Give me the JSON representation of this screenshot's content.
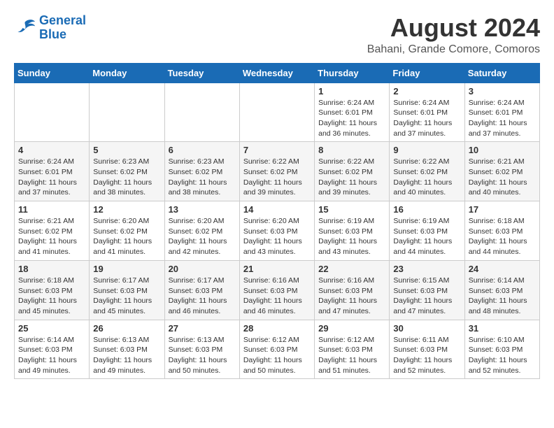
{
  "header": {
    "logo_line1": "General",
    "logo_line2": "Blue",
    "month_year": "August 2024",
    "location": "Bahani, Grande Comore, Comoros"
  },
  "days_of_week": [
    "Sunday",
    "Monday",
    "Tuesday",
    "Wednesday",
    "Thursday",
    "Friday",
    "Saturday"
  ],
  "weeks": [
    [
      {
        "day": "",
        "detail": ""
      },
      {
        "day": "",
        "detail": ""
      },
      {
        "day": "",
        "detail": ""
      },
      {
        "day": "",
        "detail": ""
      },
      {
        "day": "1",
        "detail": "Sunrise: 6:24 AM\nSunset: 6:01 PM\nDaylight: 11 hours\nand 36 minutes."
      },
      {
        "day": "2",
        "detail": "Sunrise: 6:24 AM\nSunset: 6:01 PM\nDaylight: 11 hours\nand 37 minutes."
      },
      {
        "day": "3",
        "detail": "Sunrise: 6:24 AM\nSunset: 6:01 PM\nDaylight: 11 hours\nand 37 minutes."
      }
    ],
    [
      {
        "day": "4",
        "detail": "Sunrise: 6:24 AM\nSunset: 6:01 PM\nDaylight: 11 hours\nand 37 minutes."
      },
      {
        "day": "5",
        "detail": "Sunrise: 6:23 AM\nSunset: 6:02 PM\nDaylight: 11 hours\nand 38 minutes."
      },
      {
        "day": "6",
        "detail": "Sunrise: 6:23 AM\nSunset: 6:02 PM\nDaylight: 11 hours\nand 38 minutes."
      },
      {
        "day": "7",
        "detail": "Sunrise: 6:22 AM\nSunset: 6:02 PM\nDaylight: 11 hours\nand 39 minutes."
      },
      {
        "day": "8",
        "detail": "Sunrise: 6:22 AM\nSunset: 6:02 PM\nDaylight: 11 hours\nand 39 minutes."
      },
      {
        "day": "9",
        "detail": "Sunrise: 6:22 AM\nSunset: 6:02 PM\nDaylight: 11 hours\nand 40 minutes."
      },
      {
        "day": "10",
        "detail": "Sunrise: 6:21 AM\nSunset: 6:02 PM\nDaylight: 11 hours\nand 40 minutes."
      }
    ],
    [
      {
        "day": "11",
        "detail": "Sunrise: 6:21 AM\nSunset: 6:02 PM\nDaylight: 11 hours\nand 41 minutes."
      },
      {
        "day": "12",
        "detail": "Sunrise: 6:20 AM\nSunset: 6:02 PM\nDaylight: 11 hours\nand 41 minutes."
      },
      {
        "day": "13",
        "detail": "Sunrise: 6:20 AM\nSunset: 6:02 PM\nDaylight: 11 hours\nand 42 minutes."
      },
      {
        "day": "14",
        "detail": "Sunrise: 6:20 AM\nSunset: 6:03 PM\nDaylight: 11 hours\nand 43 minutes."
      },
      {
        "day": "15",
        "detail": "Sunrise: 6:19 AM\nSunset: 6:03 PM\nDaylight: 11 hours\nand 43 minutes."
      },
      {
        "day": "16",
        "detail": "Sunrise: 6:19 AM\nSunset: 6:03 PM\nDaylight: 11 hours\nand 44 minutes."
      },
      {
        "day": "17",
        "detail": "Sunrise: 6:18 AM\nSunset: 6:03 PM\nDaylight: 11 hours\nand 44 minutes."
      }
    ],
    [
      {
        "day": "18",
        "detail": "Sunrise: 6:18 AM\nSunset: 6:03 PM\nDaylight: 11 hours\nand 45 minutes."
      },
      {
        "day": "19",
        "detail": "Sunrise: 6:17 AM\nSunset: 6:03 PM\nDaylight: 11 hours\nand 45 minutes."
      },
      {
        "day": "20",
        "detail": "Sunrise: 6:17 AM\nSunset: 6:03 PM\nDaylight: 11 hours\nand 46 minutes."
      },
      {
        "day": "21",
        "detail": "Sunrise: 6:16 AM\nSunset: 6:03 PM\nDaylight: 11 hours\nand 46 minutes."
      },
      {
        "day": "22",
        "detail": "Sunrise: 6:16 AM\nSunset: 6:03 PM\nDaylight: 11 hours\nand 47 minutes."
      },
      {
        "day": "23",
        "detail": "Sunrise: 6:15 AM\nSunset: 6:03 PM\nDaylight: 11 hours\nand 47 minutes."
      },
      {
        "day": "24",
        "detail": "Sunrise: 6:14 AM\nSunset: 6:03 PM\nDaylight: 11 hours\nand 48 minutes."
      }
    ],
    [
      {
        "day": "25",
        "detail": "Sunrise: 6:14 AM\nSunset: 6:03 PM\nDaylight: 11 hours\nand 49 minutes."
      },
      {
        "day": "26",
        "detail": "Sunrise: 6:13 AM\nSunset: 6:03 PM\nDaylight: 11 hours\nand 49 minutes."
      },
      {
        "day": "27",
        "detail": "Sunrise: 6:13 AM\nSunset: 6:03 PM\nDaylight: 11 hours\nand 50 minutes."
      },
      {
        "day": "28",
        "detail": "Sunrise: 6:12 AM\nSunset: 6:03 PM\nDaylight: 11 hours\nand 50 minutes."
      },
      {
        "day": "29",
        "detail": "Sunrise: 6:12 AM\nSunset: 6:03 PM\nDaylight: 11 hours\nand 51 minutes."
      },
      {
        "day": "30",
        "detail": "Sunrise: 6:11 AM\nSunset: 6:03 PM\nDaylight: 11 hours\nand 52 minutes."
      },
      {
        "day": "31",
        "detail": "Sunrise: 6:10 AM\nSunset: 6:03 PM\nDaylight: 11 hours\nand 52 minutes."
      }
    ]
  ]
}
